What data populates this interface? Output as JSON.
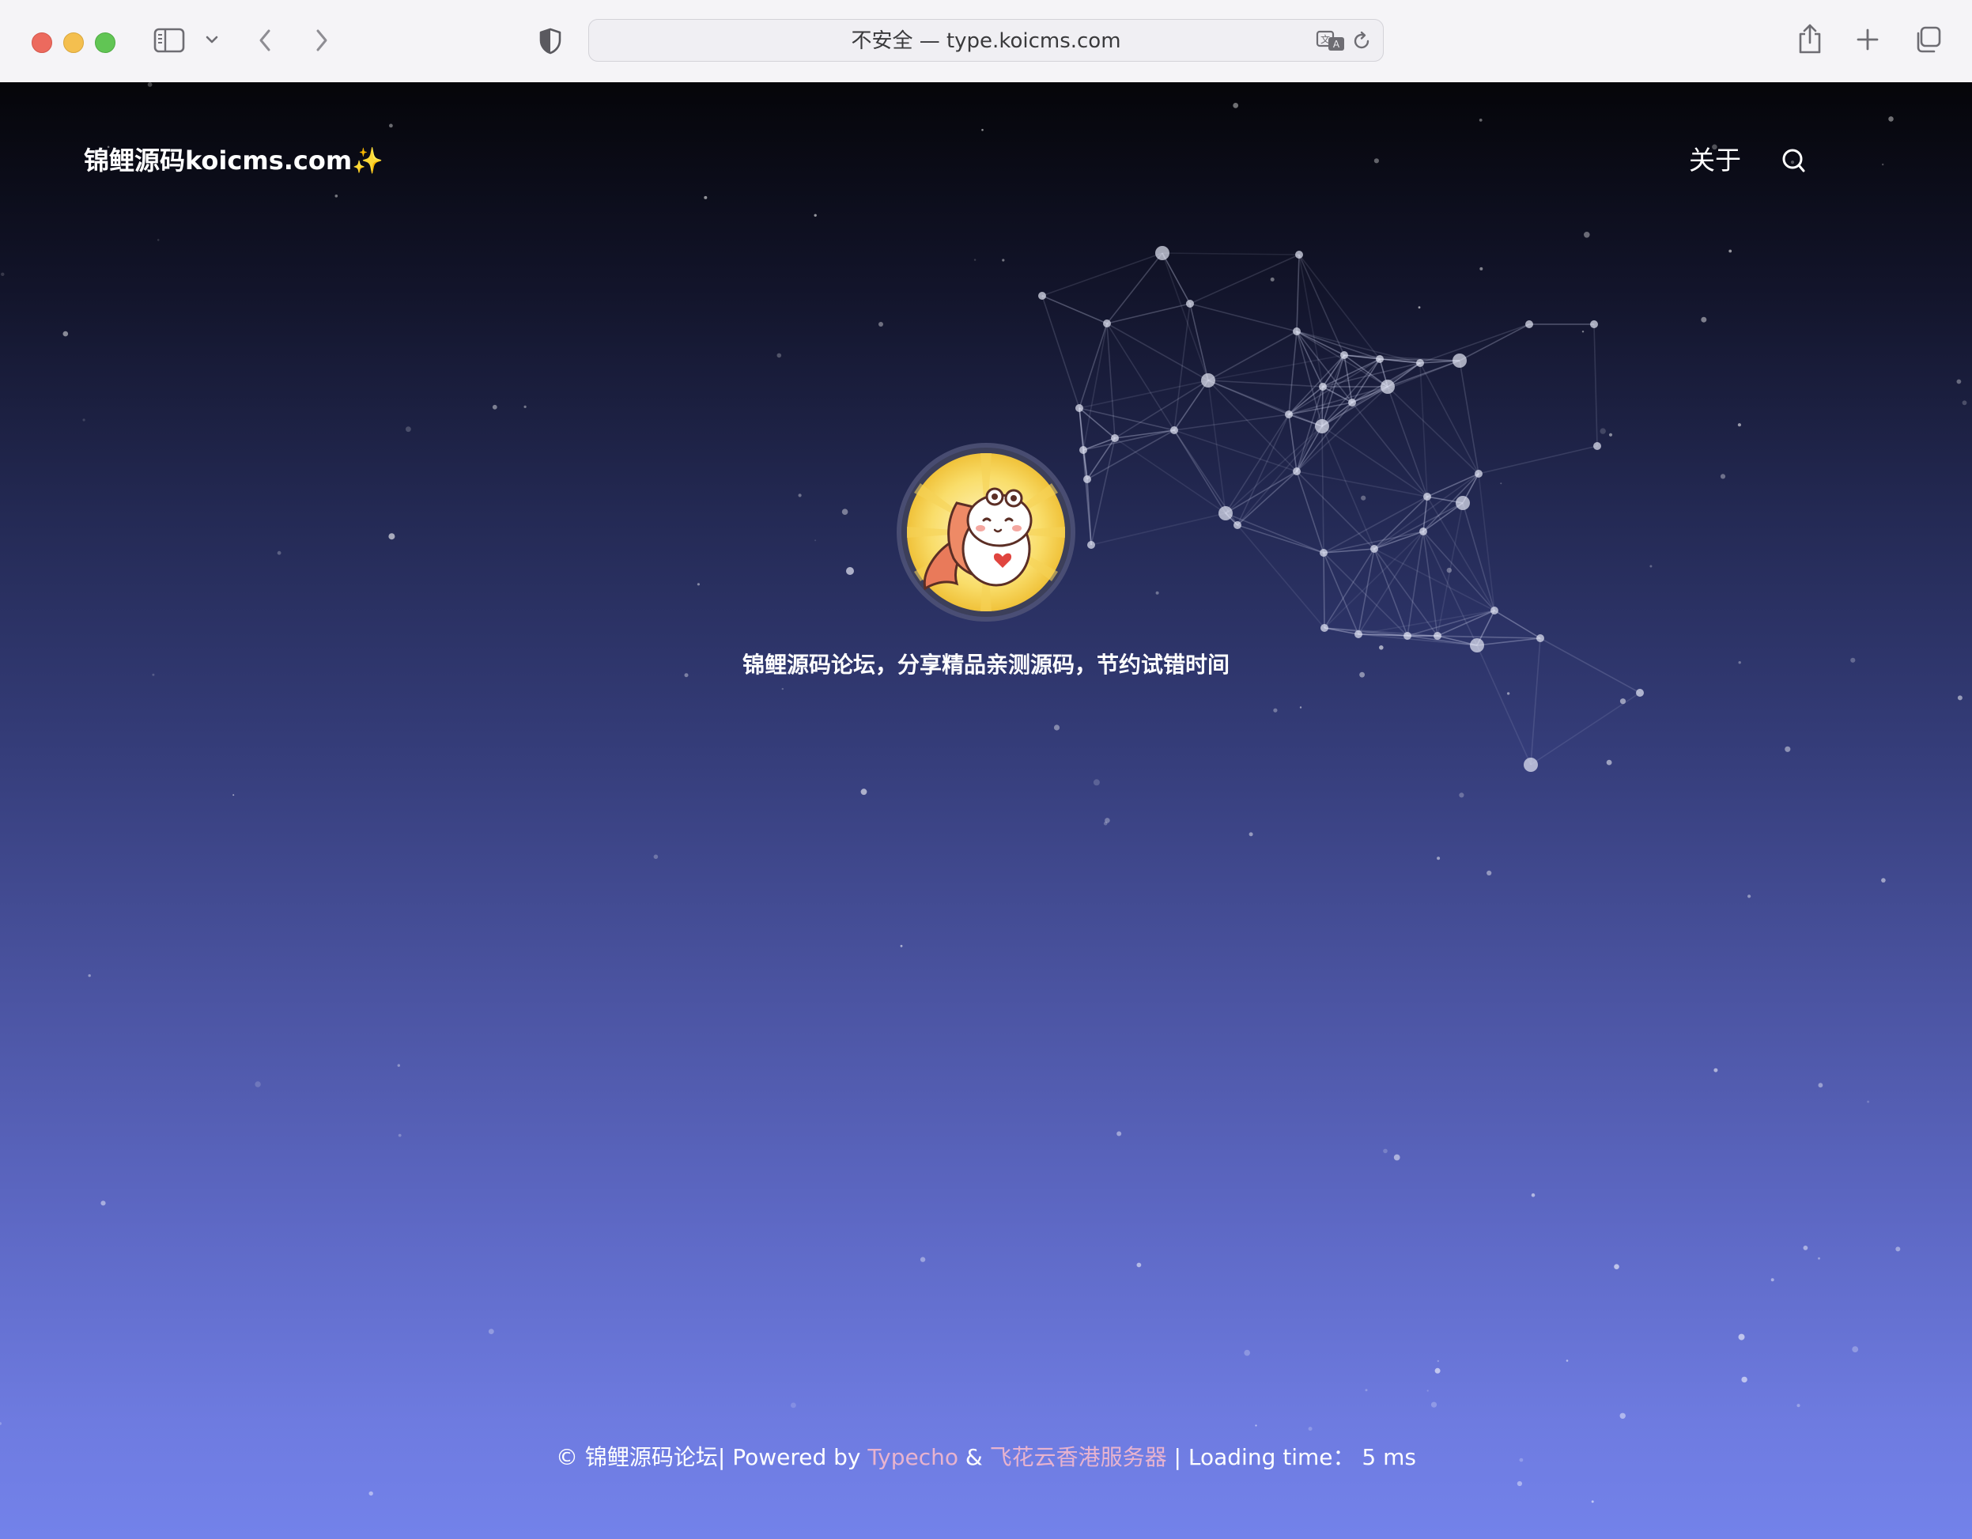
{
  "browser": {
    "address_text": "不安全 — type.koicms.com"
  },
  "site": {
    "title": "锦鲤源码koicms.com✨",
    "nav": {
      "about": "关于"
    },
    "tagline": "锦鲤源码论坛，分享精品亲测源码，节约试错时间"
  },
  "footer": {
    "copyright": "© 锦鲤源码论坛| Powered by ",
    "typecho": "Typecho",
    "amp": " & ",
    "host": "飞花云香港服务器",
    "loading_label": " | Loading time： ",
    "loading_value": "5 ms"
  },
  "colors": {
    "link": "#e8b3cf",
    "accent_red": "#ec6a5e",
    "accent_yellow": "#f4bf4f",
    "accent_green": "#61c554"
  }
}
